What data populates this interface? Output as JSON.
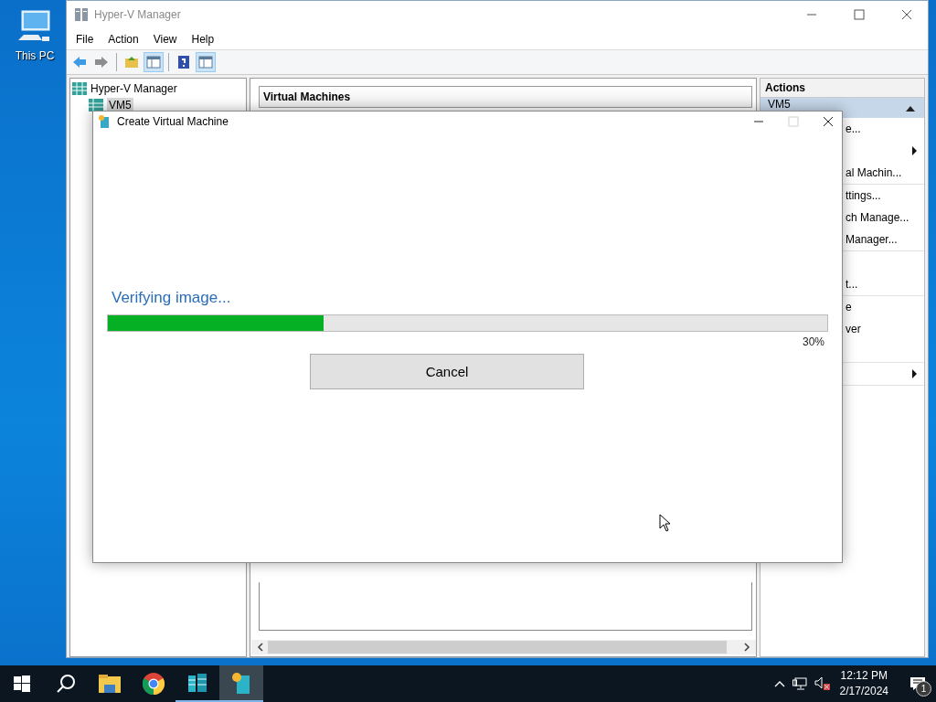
{
  "desktop": {
    "icons": [
      {
        "label": "This PC"
      }
    ]
  },
  "main_window": {
    "title": "Hyper-V Manager",
    "menu": [
      "File",
      "Action",
      "View",
      "Help"
    ],
    "toolbar": [
      {
        "kind": "back",
        "selected": false
      },
      {
        "kind": "forward",
        "selected": false
      },
      {
        "kind": "up",
        "selected": false
      },
      {
        "kind": "tree",
        "selected": true
      },
      {
        "kind": "help",
        "selected": false
      },
      {
        "kind": "pane",
        "selected": true
      }
    ],
    "tree": {
      "label": "Hyper-V Manager",
      "children": [
        {
          "label": "VM5",
          "selected": true
        }
      ]
    },
    "center": {
      "header": "Virtual Machines"
    },
    "actions": {
      "title": "Actions",
      "section": "VM5",
      "groups": [
        [
          {
            "label": "e...",
            "has_submenu": false
          },
          {
            "has_submenu": true
          },
          {
            "label": "al Machin...",
            "has_submenu": false
          }
        ],
        [
          {
            "label": "ttings...",
            "has_submenu": false
          },
          {
            "label": "ch Manage...",
            "has_submenu": false
          },
          {
            "label": "Manager...",
            "has_submenu": false
          }
        ],
        [
          {
            "has_submenu": false
          },
          {
            "label": "t...",
            "has_submenu": false
          }
        ],
        [
          {
            "label": "e",
            "has_submenu": false
          },
          {
            "label": "ver",
            "has_submenu": false
          },
          {
            "has_submenu": false
          }
        ],
        [
          {
            "has_submenu": true
          }
        ]
      ]
    }
  },
  "dialog": {
    "title": "Create Virtual Machine",
    "maximize_disabled": true,
    "status": "Verifying image...",
    "progress": {
      "level": 0.3,
      "reading": "30%"
    },
    "button": "Cancel"
  },
  "taskbar": {
    "apps": [
      {
        "kind": "explorer",
        "running": false,
        "selected": false
      },
      {
        "kind": "chrome",
        "running": false,
        "selected": false
      },
      {
        "kind": "hyperv",
        "running": true,
        "selected": false
      },
      {
        "kind": "vmcreate",
        "running": true,
        "selected": true
      }
    ],
    "time": "12:12 PM",
    "date": "2/17/2024",
    "notifications": "1"
  }
}
